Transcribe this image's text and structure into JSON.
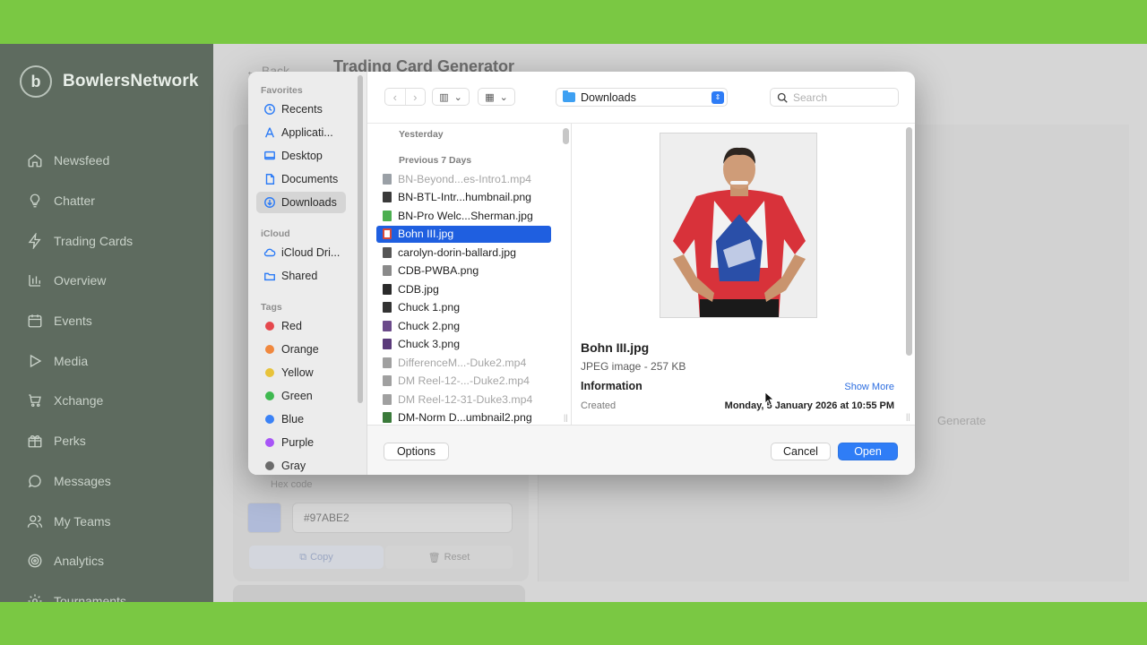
{
  "brand": {
    "name": "BowlersNetwork",
    "logo_glyph": "b"
  },
  "sidebar": {
    "items": [
      {
        "label": "Newsfeed",
        "icon": "home-icon"
      },
      {
        "label": "Chatter",
        "icon": "lightbulb-icon"
      },
      {
        "label": "Trading Cards",
        "icon": "bolt-icon"
      },
      {
        "label": "Overview",
        "icon": "bar-chart-icon"
      },
      {
        "label": "Events",
        "icon": "calendar-icon"
      },
      {
        "label": "Media",
        "icon": "play-icon"
      },
      {
        "label": "Xchange",
        "icon": "cart-icon"
      },
      {
        "label": "Perks",
        "icon": "gift-icon"
      },
      {
        "label": "Messages",
        "icon": "chat-icon"
      },
      {
        "label": "My Teams",
        "icon": "users-icon"
      },
      {
        "label": "Analytics",
        "icon": "target-icon"
      },
      {
        "label": "Tournaments",
        "icon": "gear-icon"
      }
    ]
  },
  "main": {
    "back_label": "← Back",
    "title": "Trading Card Generator",
    "generate_hint": "Generate",
    "hex_label": "Hex code",
    "hex_value": "#97ABE2",
    "swatch_color": "#97abe2",
    "copy_label": "Copy",
    "reset_label": "Reset"
  },
  "dialog": {
    "sidebar": {
      "favorites_label": "Favorites",
      "favorites": [
        {
          "label": "Recents",
          "icon": "clock-icon"
        },
        {
          "label": "Applicati...",
          "icon": "applications-icon"
        },
        {
          "label": "Desktop",
          "icon": "desktop-icon"
        },
        {
          "label": "Documents",
          "icon": "document-icon"
        },
        {
          "label": "Downloads",
          "icon": "download-icon",
          "active": true
        }
      ],
      "icloud_label": "iCloud",
      "icloud": [
        {
          "label": "iCloud Dri...",
          "icon": "cloud-icon"
        },
        {
          "label": "Shared",
          "icon": "shared-folder-icon"
        }
      ],
      "tags_label": "Tags",
      "tags": [
        {
          "label": "Red",
          "color": "#e5484d"
        },
        {
          "label": "Orange",
          "color": "#f0883e"
        },
        {
          "label": "Yellow",
          "color": "#e8c33a"
        },
        {
          "label": "Green",
          "color": "#3fb950"
        },
        {
          "label": "Blue",
          "color": "#3b82f6"
        },
        {
          "label": "Purple",
          "color": "#a855f7"
        },
        {
          "label": "Gray",
          "color": "#6b6b6b"
        }
      ]
    },
    "toolbar": {
      "location": "Downloads",
      "search_placeholder": "Search"
    },
    "groups": {
      "yesterday": "Yesterday",
      "previous7": "Previous 7 Days"
    },
    "files": [
      {
        "name": "BN-Beyond...es-Intro1.mp4",
        "dim": true,
        "icon_color": "#9aa0a6"
      },
      {
        "name": "BN-BTL-Intr...humbnail.png",
        "dim": false,
        "icon_color": "#3a3a3a"
      },
      {
        "name": "BN-Pro Welc...Sherman.jpg",
        "dim": false,
        "icon_color": "#4caf50"
      },
      {
        "name": "Bohn III.jpg",
        "dim": false,
        "selected": true,
        "icon_color": "#d84a3a"
      },
      {
        "name": "carolyn-dorin-ballard.jpg",
        "dim": false,
        "icon_color": "#555555"
      },
      {
        "name": "CDB-PWBA.png",
        "dim": false,
        "icon_color": "#8a8a8a"
      },
      {
        "name": "CDB.jpg",
        "dim": false,
        "icon_color": "#2a2a2a"
      },
      {
        "name": "Chuck 1.png",
        "dim": false,
        "icon_color": "#333333"
      },
      {
        "name": "Chuck 2.png",
        "dim": false,
        "icon_color": "#6b4a8a"
      },
      {
        "name": "Chuck 3.png",
        "dim": false,
        "icon_color": "#5a3a7a"
      },
      {
        "name": "DifferenceM...-Duke2.mp4",
        "dim": true,
        "icon_color": "#a0a0a0"
      },
      {
        "name": "DM Reel-12-...-Duke2.mp4",
        "dim": true,
        "icon_color": "#a0a0a0"
      },
      {
        "name": "DM Reel-12-31-Duke3.mp4",
        "dim": true,
        "icon_color": "#a0a0a0"
      },
      {
        "name": "DM-Norm D...umbnail2.png",
        "dim": false,
        "icon_color": "#3a7a3a"
      }
    ],
    "preview": {
      "name": "Bohn III.jpg",
      "kind": "JPEG image - 257 KB",
      "info_label": "Information",
      "show_more": "Show More",
      "created_label": "Created",
      "created_value": "Monday, 5 January 2026 at 10:55 PM"
    },
    "buttons": {
      "options": "Options",
      "cancel": "Cancel",
      "open": "Open"
    }
  }
}
